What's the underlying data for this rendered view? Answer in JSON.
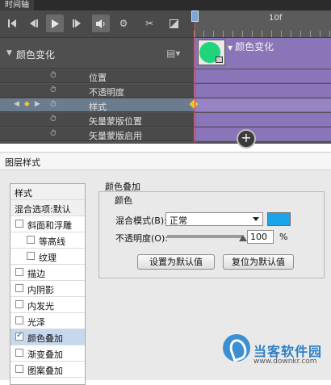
{
  "timeline": {
    "tab_title": "时间轴",
    "ruler_label": "10f",
    "layer_name": "颜色变化",
    "track_title": "颜色变化",
    "properties": [
      {
        "label": "位置",
        "selected": false,
        "has_nav": false
      },
      {
        "label": "不透明度",
        "selected": false,
        "has_nav": false
      },
      {
        "label": "样式",
        "selected": true,
        "has_nav": true
      },
      {
        "label": "矢量蒙版位置",
        "selected": false,
        "has_nav": false
      },
      {
        "label": "矢量蒙版启用",
        "selected": false,
        "has_nav": false
      }
    ],
    "toolbar_icons": [
      "first-frame-icon",
      "prev-frame-icon",
      "play-icon",
      "next-frame-icon",
      "audio-icon",
      "gear-icon",
      "scissors-icon",
      "transition-icon"
    ],
    "colors": {
      "track": "#8a75b8",
      "keyframe": "#f1c233",
      "playhead": "#e04040",
      "thumb_blob": "#21d37a"
    }
  },
  "dialog": {
    "title": "图层样式",
    "left_list": [
      {
        "label": "样式",
        "type": "header"
      },
      {
        "label": "混合选项:默认",
        "type": "header"
      },
      {
        "label": "斜面和浮雕",
        "type": "check",
        "checked": false
      },
      {
        "label": "等高线",
        "type": "subcheck",
        "checked": false
      },
      {
        "label": "纹理",
        "type": "subcheck",
        "checked": false
      },
      {
        "label": "描边",
        "type": "check",
        "checked": false
      },
      {
        "label": "内阴影",
        "type": "check",
        "checked": false
      },
      {
        "label": "内发光",
        "type": "check",
        "checked": false
      },
      {
        "label": "光泽",
        "type": "check",
        "checked": false
      },
      {
        "label": "颜色叠加",
        "type": "check",
        "checked": true
      },
      {
        "label": "渐变叠加",
        "type": "check",
        "checked": false
      },
      {
        "label": "图案叠加",
        "type": "check",
        "checked": false
      }
    ],
    "group_title": "颜色叠加",
    "sub_title": "颜色",
    "blend_label": "混合模式(B):",
    "blend_value": "正常",
    "overlay_color": "#1ba4ea",
    "opacity_label": "不透明度(O):",
    "opacity_value": "100",
    "opacity_unit": "%",
    "opacity_fraction": 1.0,
    "btn_make_default": "设置为默认值",
    "btn_reset_default": "复位为默认值"
  },
  "watermark": {
    "name": "当客软件园",
    "url": "www.downkr.com"
  }
}
